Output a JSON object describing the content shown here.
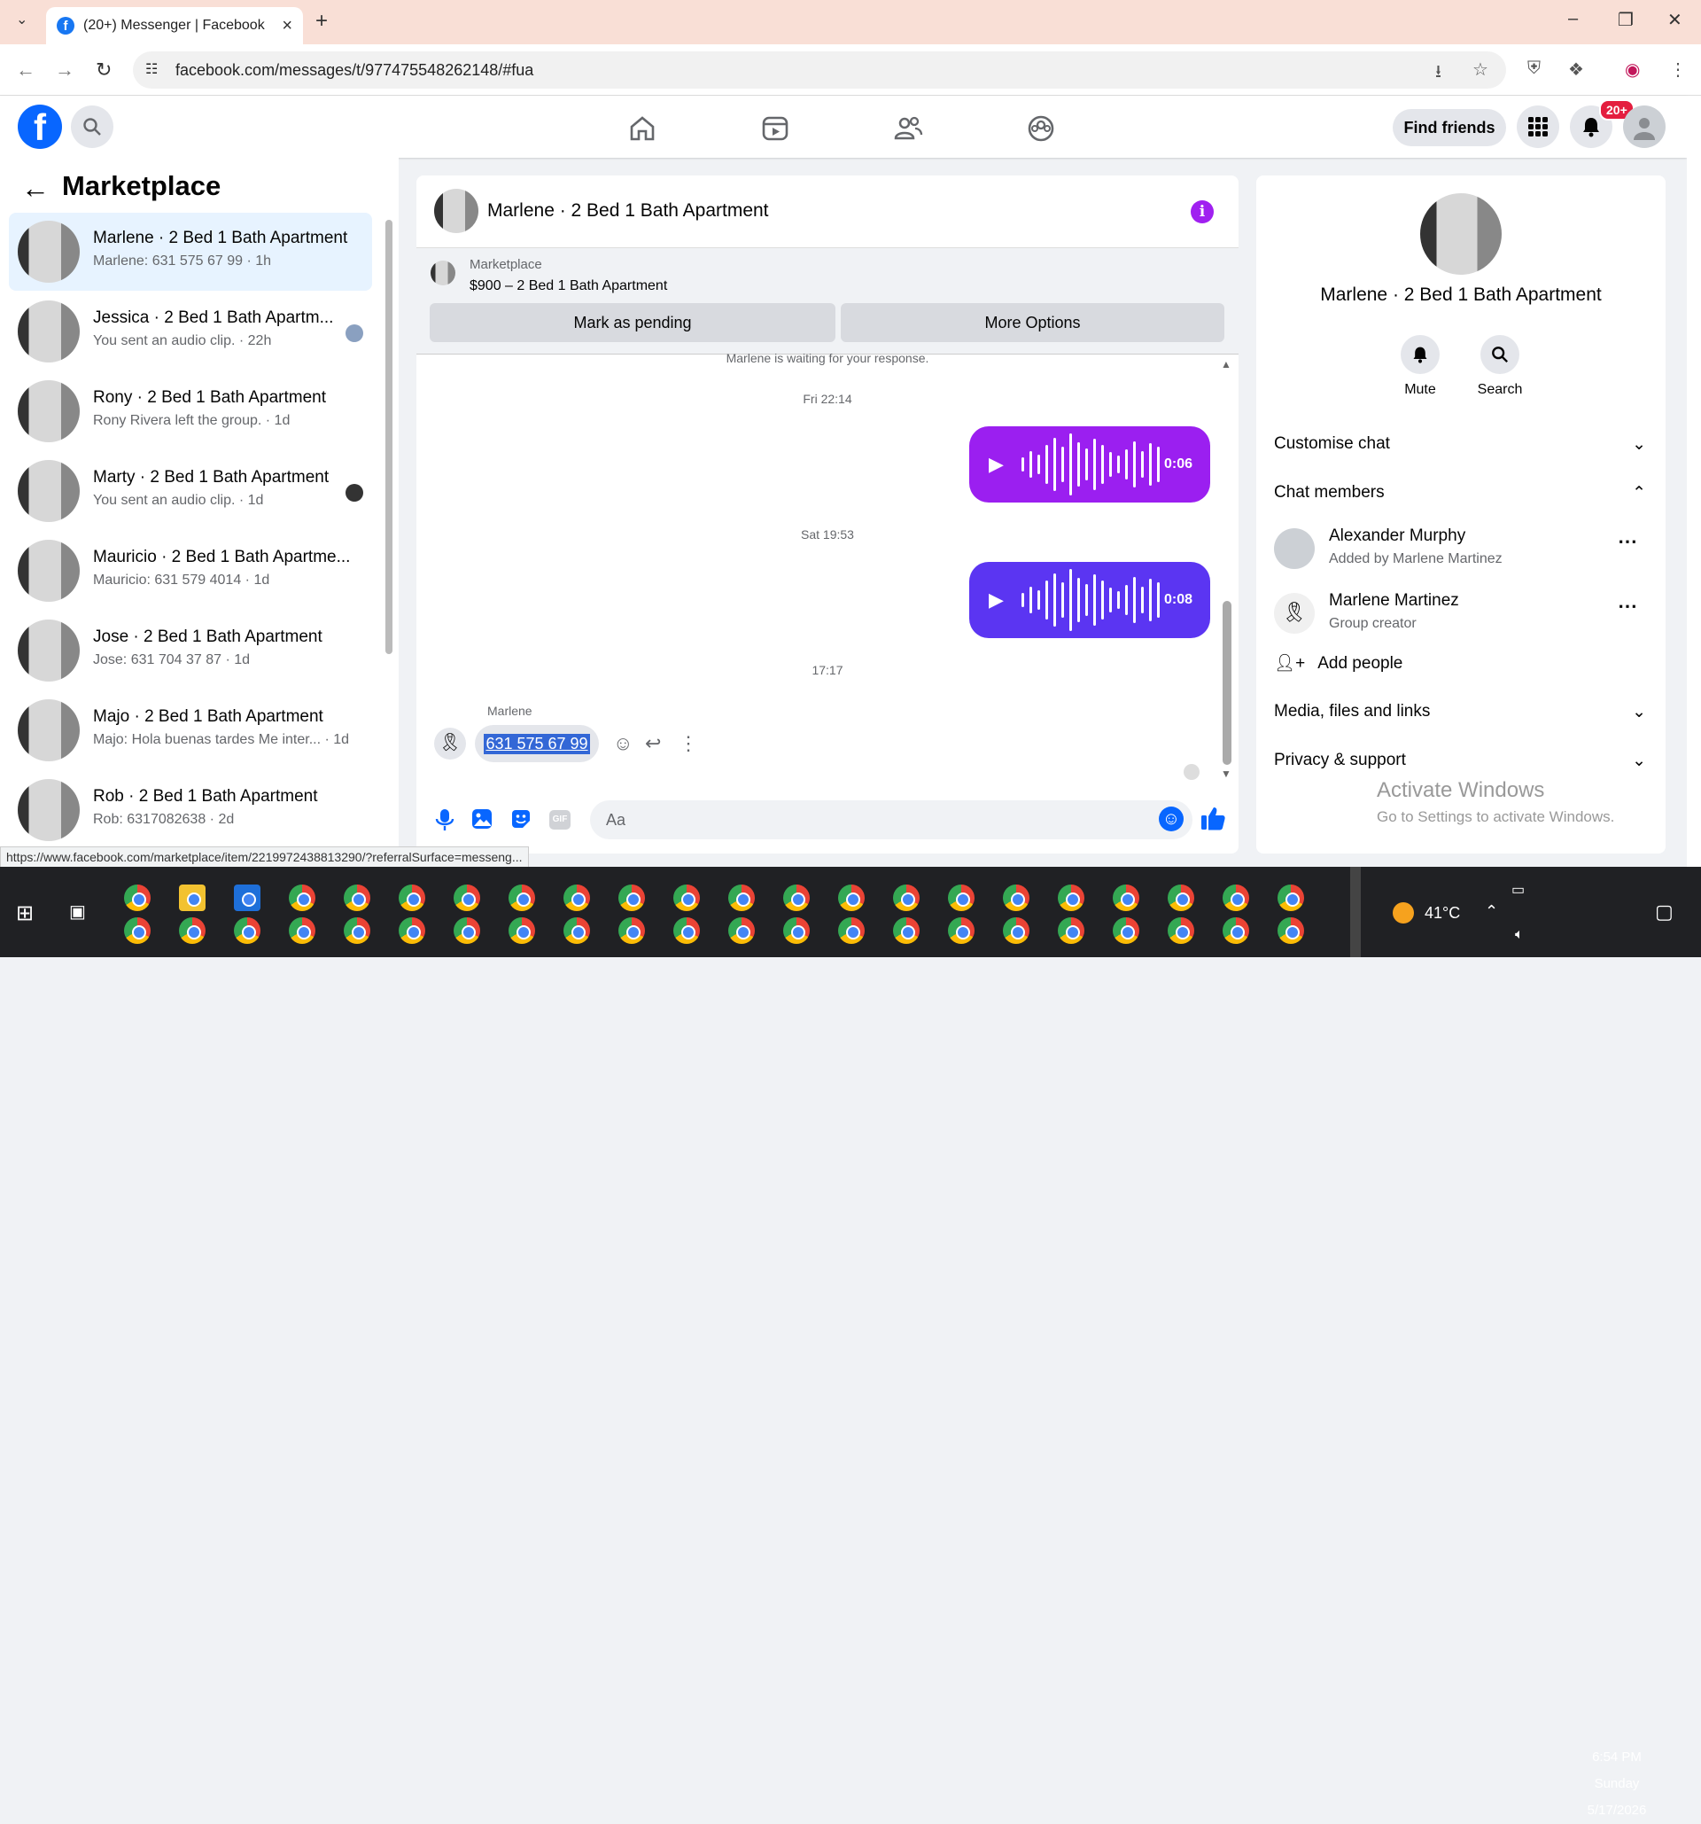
{
  "browser": {
    "tab_title": "(20+) Messenger | Facebook",
    "url": "facebook.com/messages/t/977475548262148/#fua",
    "status_url": "https://www.facebook.com/marketplace/item/2219972438813290/?referralSurface=messeng..."
  },
  "header": {
    "find_friends": "Find friends",
    "notif_badge": "20+"
  },
  "sidebar": {
    "title": "Marketplace",
    "conversations": [
      {
        "name": "Marlene · 2 Bed 1 Bath Apartment",
        "sub": "Marlene: 631 575 67 99 · 1h"
      },
      {
        "name": "Jessica · 2 Bed 1 Bath Apartm...",
        "sub": "You sent an audio clip. · 22h"
      },
      {
        "name": "Rony · 2 Bed 1 Bath Apartment",
        "sub": "Rony Rivera left the group. · 1d"
      },
      {
        "name": "Marty · 2 Bed 1 Bath Apartment",
        "sub": "You sent an audio clip. · 1d"
      },
      {
        "name": "Mauricio · 2 Bed 1 Bath Apartme...",
        "sub": "Mauricio: 631 579 4014 · 1d"
      },
      {
        "name": "Jose · 2 Bed 1 Bath Apartment",
        "sub": "Jose: 631 704 37 87 · 1d"
      },
      {
        "name": "Majo · 2 Bed 1 Bath Apartment",
        "sub": "Majo: Hola buenas tardes Me inter...  · 1d"
      },
      {
        "name": "Rob · 2 Bed 1 Bath Apartment",
        "sub": "Rob: 6317082638 · 2d"
      }
    ]
  },
  "chat": {
    "title": "Marlene · 2 Bed 1 Bath Apartment",
    "marketplace_label": "Marketplace",
    "listing": "$900 – 2 Bed 1 Bath Apartment",
    "mark_pending": "Mark as pending",
    "more_options": "More Options",
    "waiting": "Marlene is waiting for your response.",
    "ts1": "Fri 22:14",
    "audio1_duration": "0:06",
    "ts2": "Sat 19:53",
    "audio2_duration": "0:08",
    "ts3": "17:17",
    "sender": "Marlene",
    "message": "631 575 67 99",
    "composer_placeholder": "Aa",
    "audio1_color": "#9b1ff0",
    "audio2_color": "#5b35f2"
  },
  "details": {
    "title": "Marlene · 2 Bed 1 Bath Apartment",
    "mute": "Mute",
    "search": "Search",
    "customise": "Customise chat",
    "chat_members": "Chat members",
    "members": [
      {
        "name": "Alexander Murphy",
        "sub": "Added by Marlene Martinez"
      },
      {
        "name": "Marlene Martinez",
        "sub": "Group creator"
      }
    ],
    "add_people": "Add people",
    "media": "Media, files and links",
    "privacy": "Privacy & support",
    "activate1": "Activate Windows",
    "activate2": "Go to Settings to activate Windows."
  },
  "taskbar": {
    "temp": "41°C",
    "time": "6:54 PM",
    "day": "Sunday",
    "date": "5/17/2026"
  },
  "colors": {
    "accent": "#0866ff",
    "active_conv": "#e7f3ff"
  }
}
